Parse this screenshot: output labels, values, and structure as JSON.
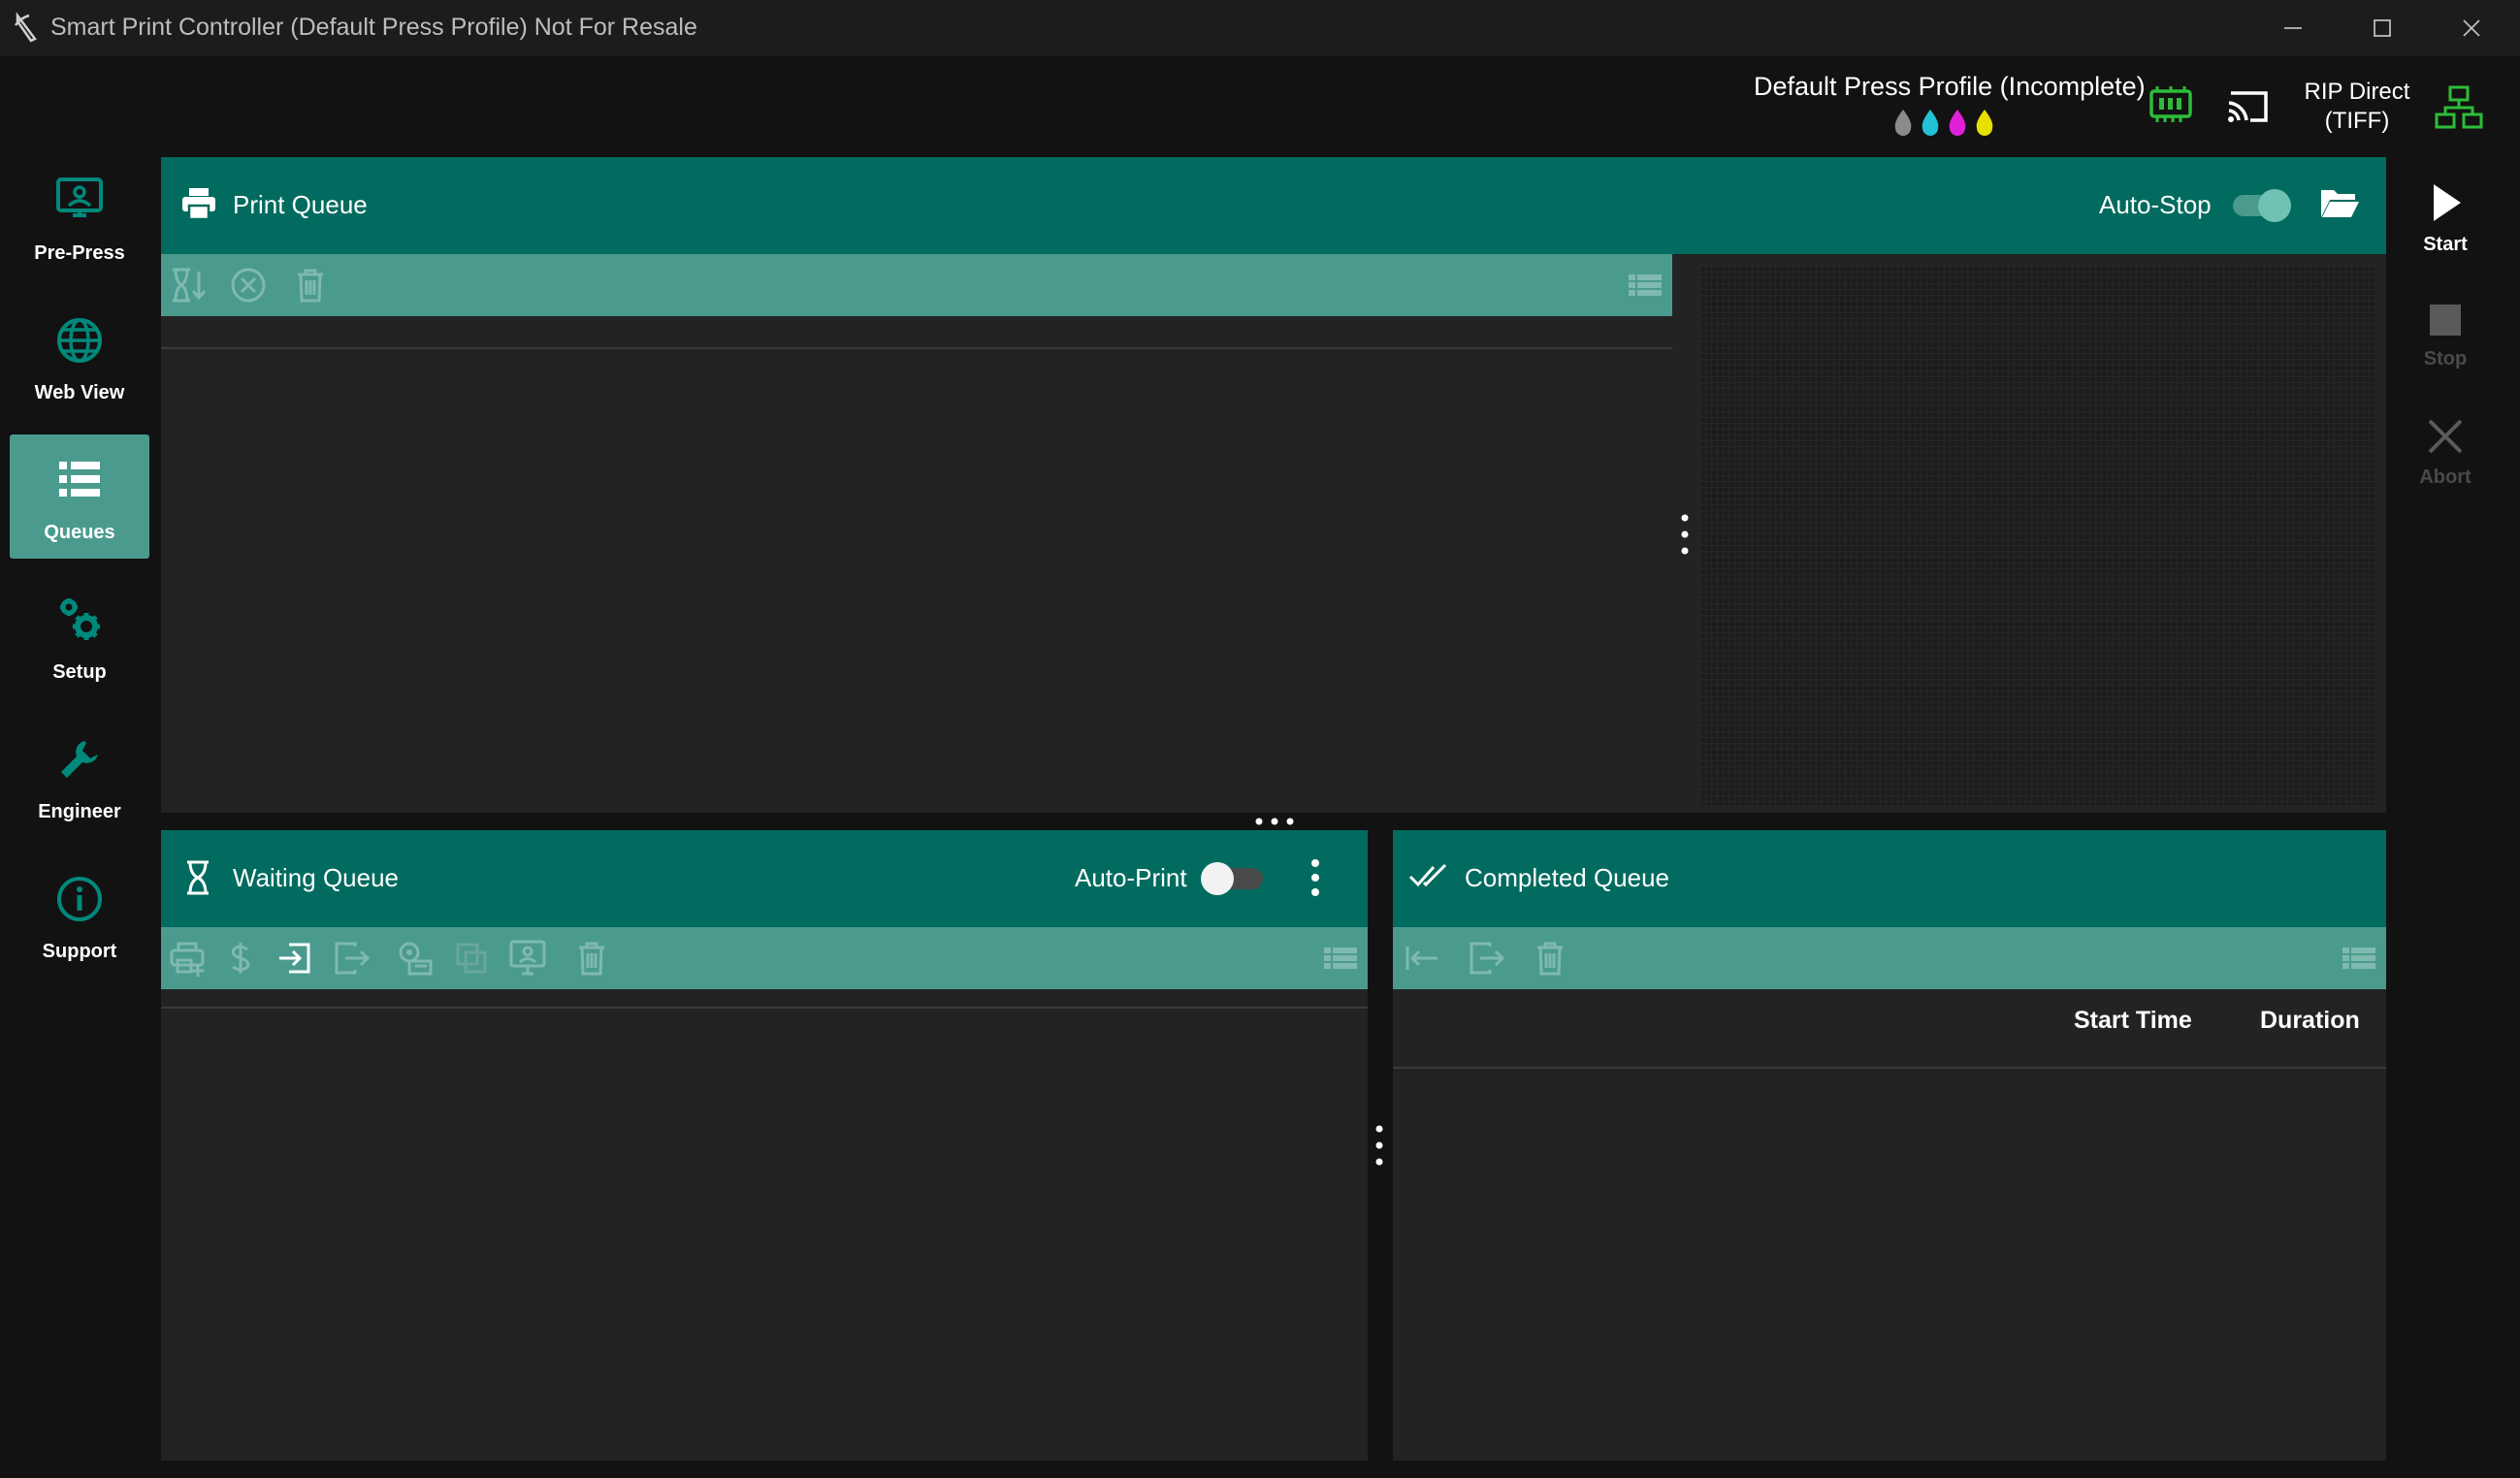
{
  "window": {
    "title": "Smart Print Controller (Default Press Profile) Not For Resale"
  },
  "status": {
    "profile": "Default Press Profile (Incomplete)",
    "rip_line1": "RIP Direct",
    "rip_line2": "(TIFF)",
    "ink_colors": [
      "#8a8a8a",
      "#22c1d6",
      "#e020d8",
      "#e8e000"
    ],
    "status_green": "#2dbd3a"
  },
  "nav": {
    "items": [
      {
        "label": "Pre-Press",
        "icon": "prepress-icon"
      },
      {
        "label": "Web View",
        "icon": "globe-icon"
      },
      {
        "label": "Queues",
        "icon": "queues-icon"
      },
      {
        "label": "Setup",
        "icon": "gears-icon"
      },
      {
        "label": "Engineer",
        "icon": "wrench-icon"
      },
      {
        "label": "Support",
        "icon": "info-icon"
      }
    ],
    "active": "Queues"
  },
  "controls": {
    "start": "Start",
    "stop": "Stop",
    "abort": "Abort"
  },
  "print_queue": {
    "title": "Print Queue",
    "auto_stop_label": "Auto-Stop",
    "auto_stop_on": true
  },
  "waiting_queue": {
    "title": "Waiting Queue",
    "auto_print_label": "Auto-Print",
    "auto_print_on": false
  },
  "completed_queue": {
    "title": "Completed Queue",
    "columns": [
      "Start Time",
      "Duration"
    ]
  },
  "colors": {
    "header": "#006b5e",
    "toolbar": "#4a9b8e",
    "panel_bg": "#232323",
    "app_bg": "#121212"
  }
}
